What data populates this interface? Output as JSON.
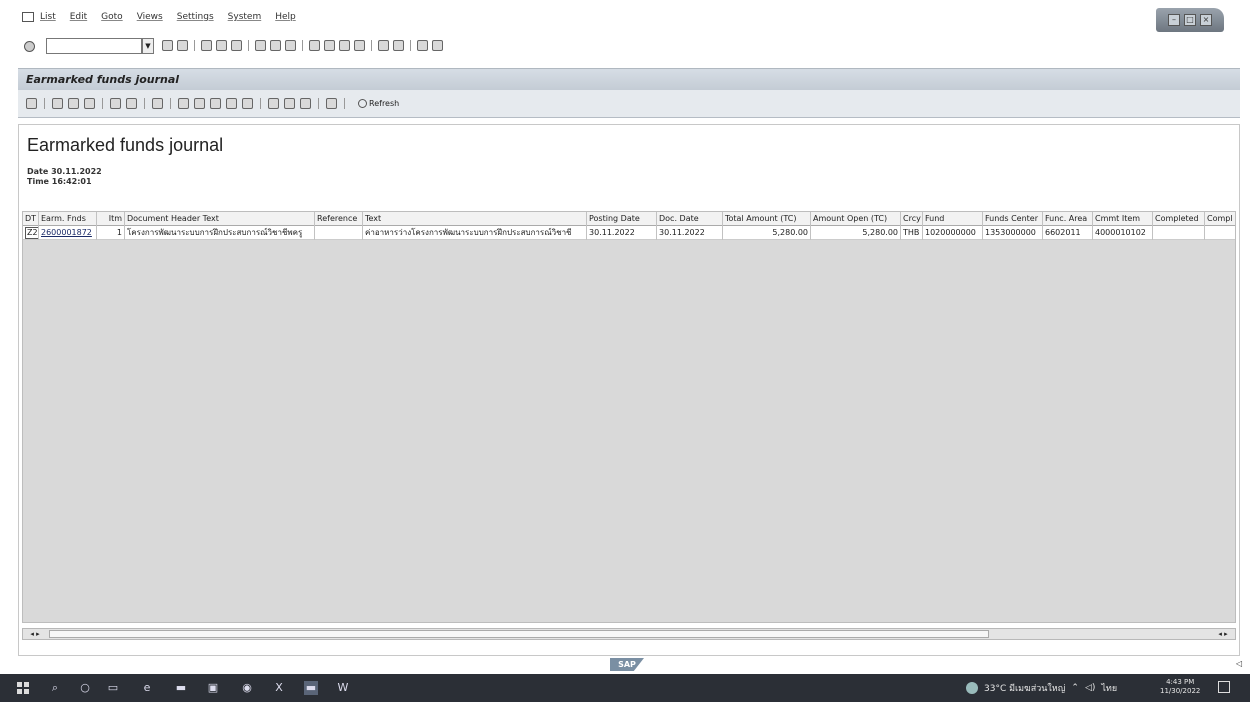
{
  "menu": {
    "items": [
      "List",
      "Edit",
      "Goto",
      "Views",
      "Settings",
      "System",
      "Help"
    ]
  },
  "window": {
    "title": "Earmarked funds journal"
  },
  "toolbar": {
    "refresh_label": "Refresh"
  },
  "report": {
    "heading": "Earmarked funds journal",
    "date_label": "Date",
    "date_value": "30.11.2022",
    "time_label": "Time",
    "time_value": "16:42:01"
  },
  "grid": {
    "columns": [
      "DT",
      "Earm. Fnds",
      "Itm",
      "Document Header Text",
      "Reference",
      "Text",
      "Posting Date",
      "Doc. Date",
      "Total Amount (TC)",
      "Amount Open (TC)",
      "Crcy",
      "Fund",
      "Funds Center",
      "Func. Area",
      "Cmmt Item",
      "Completed",
      "Compl"
    ],
    "rows": [
      [
        "Z2",
        "2600001872",
        "1",
        "โครงการพัฒนาระบบการฝึกประสบการณ์วิชาชีพครู",
        "",
        "ค่าอาหารว่างโครงการพัฒนาระบบการฝึกประสบการณ์วิชาชี",
        "30.11.2022",
        "30.11.2022",
        "5,280.00",
        "5,280.00",
        "THB",
        "1020000000",
        "1353000000",
        "6602011",
        "4000010102",
        "",
        ""
      ]
    ]
  },
  "statusbar": {
    "logo_text": "SAP"
  },
  "taskbar": {
    "weather": "33°C มีเมฆส่วนใหญ่",
    "lang": "ไทย",
    "time": "4:43 PM",
    "date": "11/30/2022"
  }
}
